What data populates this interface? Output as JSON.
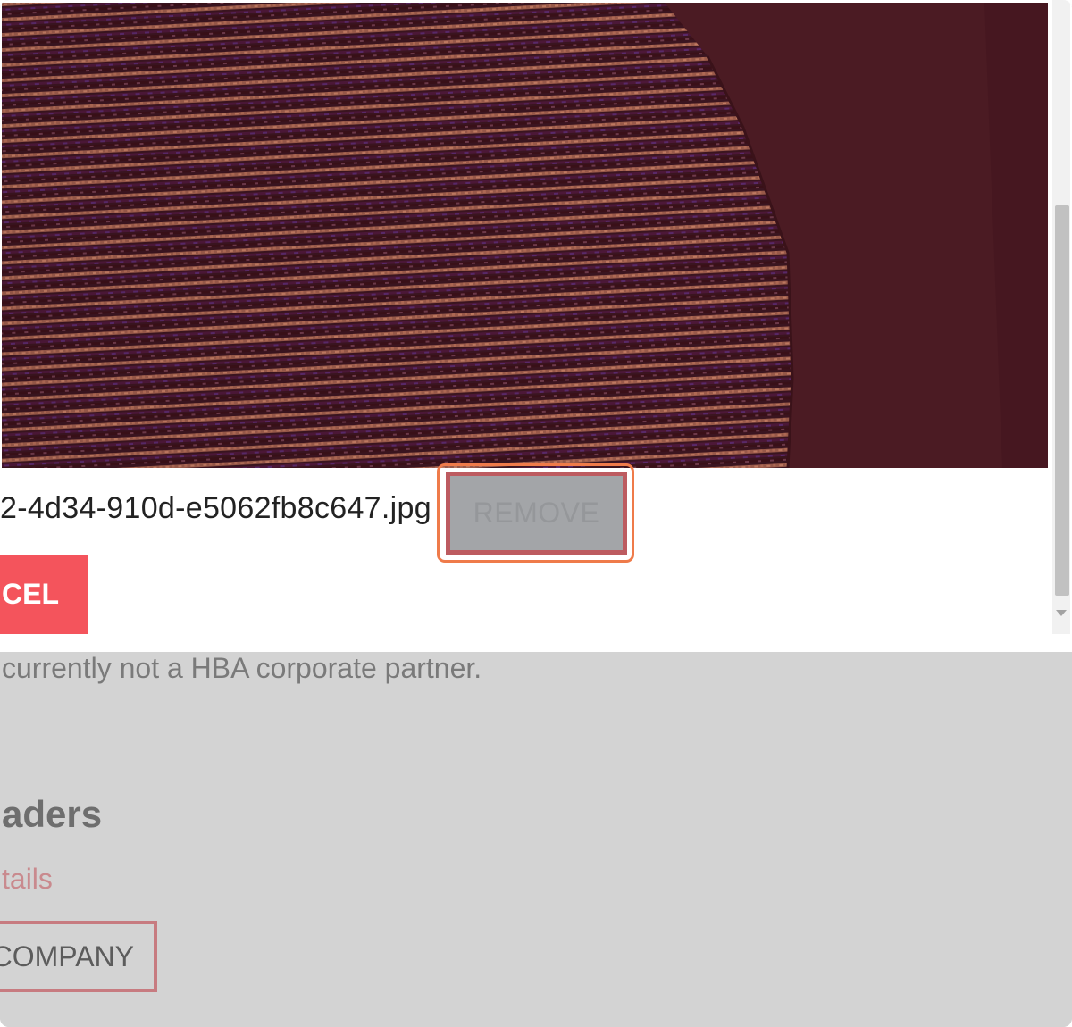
{
  "modal": {
    "image_alt": "uploaded photo of knitted fabric",
    "filename": "2-4d34-910d-e5062fb8c647.jpg",
    "remove_label": "REMOVE",
    "cancel_label": "CEL"
  },
  "background": {
    "partner_text": "currently not a HBA corporate partner.",
    "heading": "aders",
    "details_link": "tails",
    "company_button": "COMPANY"
  },
  "colors": {
    "cancel": "#f4545c",
    "remove_bg": "#a3a5a8",
    "highlight": "#ef7b4a",
    "overlay": "#d3d3d3"
  }
}
